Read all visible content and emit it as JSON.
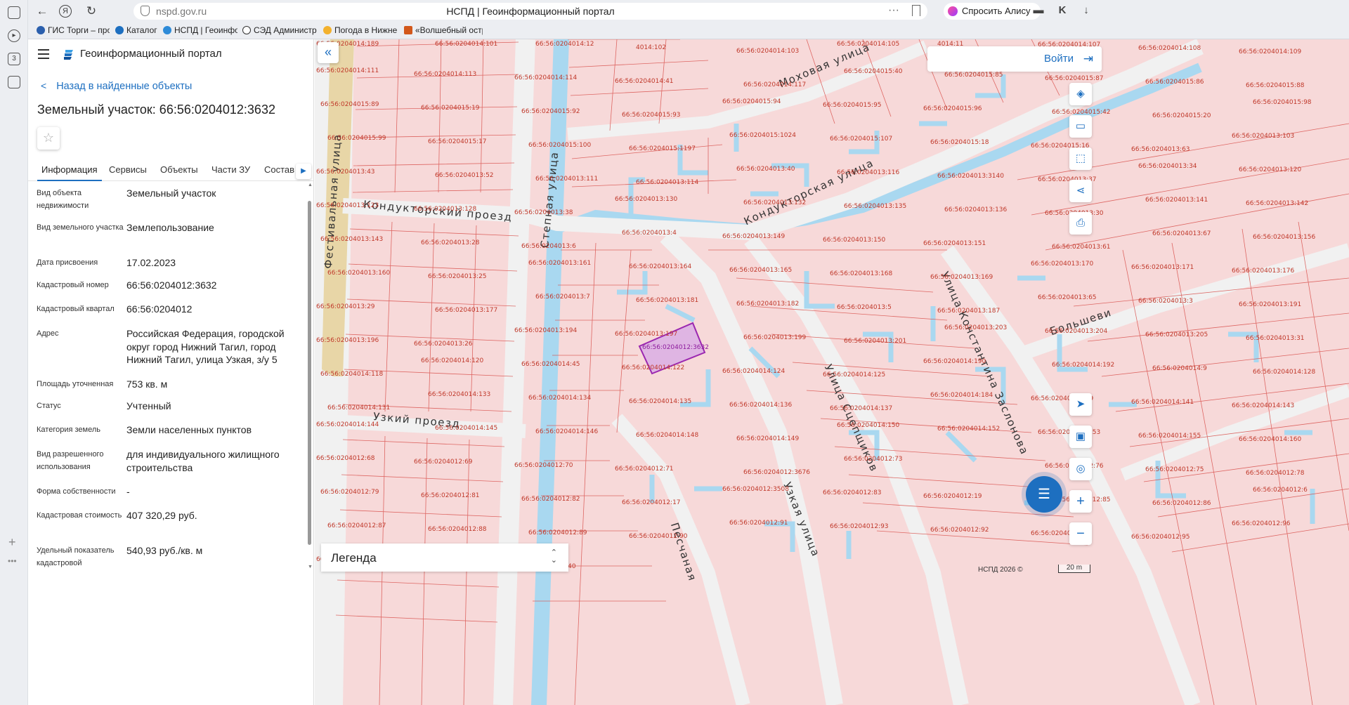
{
  "browser": {
    "url": "nspd.gov.ru",
    "page_title": "НСПД | Геоинформационный портал",
    "alice_button": "Спросить Алису AI",
    "bookmarks": [
      "ГИС Торги – прод",
      "Каталог",
      "НСПД | Геоинфор",
      "СЭД Администра",
      "Погода в Нижнем",
      "«Волшебный остр"
    ],
    "sidebar_badge": "3"
  },
  "panel": {
    "portal_title": "Геоинформационный портал",
    "back_link": "Назад в найденные объекты",
    "object_title": "Земельный участок: 66:56:0204012:3632",
    "tabs": [
      "Информация",
      "Сервисы",
      "Объекты",
      "Части ЗУ",
      "Состав"
    ],
    "rows": [
      {
        "label": "Вид объекта недвижимости",
        "value": "Земельный участок"
      },
      {
        "label": "Вид земельного участка",
        "value": "Землепользование"
      },
      {
        "label": "Дата присвоения",
        "value": "17.02.2023"
      },
      {
        "label": "Кадастровый номер",
        "value": "66:56:0204012:3632"
      },
      {
        "label": "Кадастровый квартал",
        "value": "66:56:0204012"
      },
      {
        "label": "Адрес",
        "value": "Российская Федерация, городской округ город Нижний Тагил, город Нижний Тагил, улица Узкая, з/у 5"
      },
      {
        "label": "Площадь уточненная",
        "value": "753 кв. м"
      },
      {
        "label": "Статус",
        "value": "Учтенный"
      },
      {
        "label": "Категория земель",
        "value": "Земли населенных пунктов"
      },
      {
        "label": "Вид разрешенного использования",
        "value": "для индивидуального жилищного строительства"
      },
      {
        "label": "Форма собственности",
        "value": "-"
      },
      {
        "label": "Кадастровая стоимость",
        "value": "407 320,29 руб."
      },
      {
        "label": "Удельный показатель кадастровой",
        "value": "540,93 руб./кв. м"
      }
    ]
  },
  "map": {
    "login": "Войти",
    "legend": "Легенда",
    "copyright": "НСПД 2026 ©",
    "scale": "20 m",
    "streets": [
      "Моховая улица",
      "Кондукторская улица",
      "Кондукторский проезд",
      "Степная улица",
      "Фестивальная улица",
      "Узкий проезд",
      "Улица Сцепщиков",
      "Улица Константина Заслонова",
      "Узкая улица",
      "Песчаная",
      "Большеви"
    ],
    "parcel_labels": [
      "66:56:0204014:189",
      "66:56:0204014:101",
      "66:56:0204014:12",
      "4014:102",
      "66:56:0204014:103",
      "66:56:0204014:105",
      "4014:11",
      "66:56:0204014:107",
      "66:56:0204014:108",
      "66:56:0204014:109",
      "66:56:0204014:111",
      "66:56:0204014:113",
      "66:56:0204014:114",
      "66:56:0204014:41",
      "66:56:0204014:117",
      "66:56:0204015:40",
      "66:56:0204015:85",
      "66:56:0204015:87",
      "66:56:0204015:86",
      "66:56:0204015:88",
      "66:56:0204015:89",
      "66:56:0204015:19",
      "66:56:0204015:92",
      "66:56:0204015:93",
      "66:56:0204015:94",
      "66:56:0204015:95",
      "66:56:0204015:96",
      "66:56:0204015:42",
      "66:56:0204015:20",
      "66:56:0204015:98",
      "66:56:0204015:99",
      "66:56:0204015:17",
      "66:56:0204015:100",
      "66:56:0204015:1197",
      "66:56:0204015:1024",
      "66:56:0204015:107",
      "66:56:0204015:18",
      "66:56:0204015:16",
      "66:56:0204013:63",
      "66:56:0204013:103",
      "66:56:0204013:43",
      "66:56:0204013:52",
      "66:56:0204013:111",
      "66:56:0204013:114",
      "66:56:0204013:40",
      "66:56:0204013:116",
      "66:56:0204013:3140",
      "66:56:0204013:37",
      "66:56:0204013:34",
      "66:56:0204013:120",
      "66:56:0204013:123",
      "66:56:0204013:128",
      "66:56:0204013:38",
      "66:56:0204013:130",
      "66:56:0204013:132",
      "66:56:0204013:135",
      "66:56:0204013:136",
      "66:56:0204013:30",
      "66:56:0204013:141",
      "66:56:0204013:142",
      "66:56:0204013:143",
      "66:56:0204013:28",
      "66:56:0204013:6",
      "66:56:0204013:4",
      "66:56:0204013:149",
      "66:56:0204013:150",
      "66:56:0204013:151",
      "66:56:0204013:61",
      "66:56:0204013:67",
      "66:56:0204013:156",
      "66:56:0204013:160",
      "66:56:0204013:25",
      "66:56:0204013:161",
      "66:56:0204013:164",
      "66:56:0204013:165",
      "66:56:0204013:168",
      "66:56:0204013:169",
      "66:56:0204013:170",
      "66:56:0204013:171",
      "66:56:0204013:176",
      "66:56:0204013:29",
      "66:56:0204013:177",
      "66:56:0204013:7",
      "66:56:0204013:181",
      "66:56:0204013:182",
      "66:56:0204013:5",
      "66:56:0204013:187",
      "66:56:0204013:65",
      "66:56:0204013:3",
      "66:56:0204013:191",
      "66:56:0204013:196",
      "66:56:0204013:26",
      "66:56:0204013:194",
      "66:56:0204013:197",
      "66:56:0204013:199",
      "66:56:0204013:201",
      "66:56:0204013:203",
      "66:56:0204013:204",
      "66:56:0204013:205",
      "66:56:0204013:31",
      "66:56:0204014:118",
      "66:56:0204014:120",
      "66:56:0204014:45",
      "66:56:0204014:122",
      "66:56:0204014:124",
      "66:56:0204014:125",
      "66:56:0204014:190",
      "66:56:0204014:192",
      "66:56:0204014:9",
      "66:56:0204014:128",
      "66:56:0204014:131",
      "66:56:0204014:133",
      "66:56:0204014:134",
      "66:56:0204014:135",
      "66:56:0204014:136",
      "66:56:0204014:137",
      "66:56:0204014:184",
      "66:56:0204014:139",
      "66:56:0204014:141",
      "66:56:0204014:143",
      "66:56:0204014:144",
      "66:56:0204014:145",
      "66:56:0204014:146",
      "66:56:0204014:148",
      "66:56:0204014:149",
      "66:56:0204014:150",
      "66:56:0204014:152",
      "66:56:0204014:153",
      "66:56:0204014:155",
      "66:56:0204014:160",
      "66:56:0204012:68",
      "66:56:0204012:69",
      "66:56:0204012:70",
      "66:56:0204012:71",
      "66:56:0204012:3676",
      "66:56:0204012:73",
      "66:56:0204012:3632",
      "66:56:0204012:76",
      "66:56:0204012:75",
      "66:56:0204012:78",
      "66:56:0204012:79",
      "66:56:0204012:81",
      "66:56:0204012:82",
      "66:56:0204012:17",
      "66:56:0204012:3508",
      "66:56:0204012:83",
      "66:56:0204012:19",
      "66:56:0204012:85",
      "66:56:0204012:86",
      "66:56:0204012:6",
      "66:56:0204012:87",
      "66:56:0204012:88",
      "66:56:0204012:89",
      "66:56:0204012:90",
      "66:56:0204012:91",
      "66:56:0204012:93",
      "66:56:0204012:92",
      "66:56:0204012:94",
      "66:56:0204012:95",
      "66:56:0204012:96",
      "66:56:0204012:3509",
      "66:56:0204012:97",
      "66:56:02040"
    ]
  },
  "colors": {
    "accent": "#1d6fc0",
    "parcel_fill": "#f7d9d9",
    "parcel_border": "#d9534f",
    "selected": "#9b27b0",
    "water": "#a9d8f0"
  }
}
